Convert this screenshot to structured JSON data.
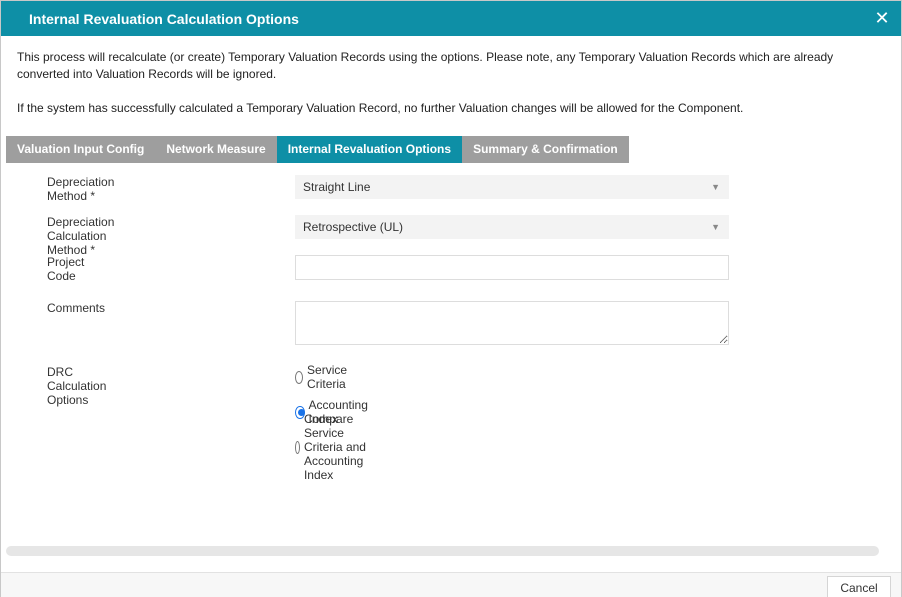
{
  "dialog": {
    "title": "Internal Revaluation Calculation Options",
    "close_icon": "close-icon"
  },
  "intro": {
    "paragraph1": "This process will recalculate (or create) Temporary Valuation Records using the options. Please note, any Temporary Valuation Records which are already converted into Valuation Records will be ignored.",
    "paragraph2": "If the system has successfully calculated a Temporary Valuation Record, no further Valuation changes will be allowed for the Component."
  },
  "tabs": [
    {
      "label": "Valuation Input Config",
      "active": false
    },
    {
      "label": "Network Measure",
      "active": false
    },
    {
      "label": "Internal Revaluation Options",
      "active": true
    },
    {
      "label": "Summary & Confirmation",
      "active": false
    }
  ],
  "form": {
    "depreciation_method": {
      "label": "Depreciation Method *",
      "value": "Straight Line"
    },
    "depreciation_calc_method": {
      "label": "Depreciation Calculation Method *",
      "value": "Retrospective (UL)"
    },
    "project_code": {
      "label": "Project Code",
      "value": ""
    },
    "comments": {
      "label": "Comments",
      "value": ""
    },
    "drc_options": {
      "label": "DRC Calculation Options",
      "options": [
        {
          "label": "Service Criteria",
          "checked": false
        },
        {
          "label": "Accounting Index",
          "checked": true
        },
        {
          "label": "Compare Service Criteria and Accounting Index",
          "checked": false
        }
      ]
    }
  },
  "footer": {
    "cancel_label": "Cancel"
  },
  "colors": {
    "accent": "#0e8fa6",
    "tab_inactive": "#9e9e9e",
    "radio_checked": "#1a73e8"
  }
}
